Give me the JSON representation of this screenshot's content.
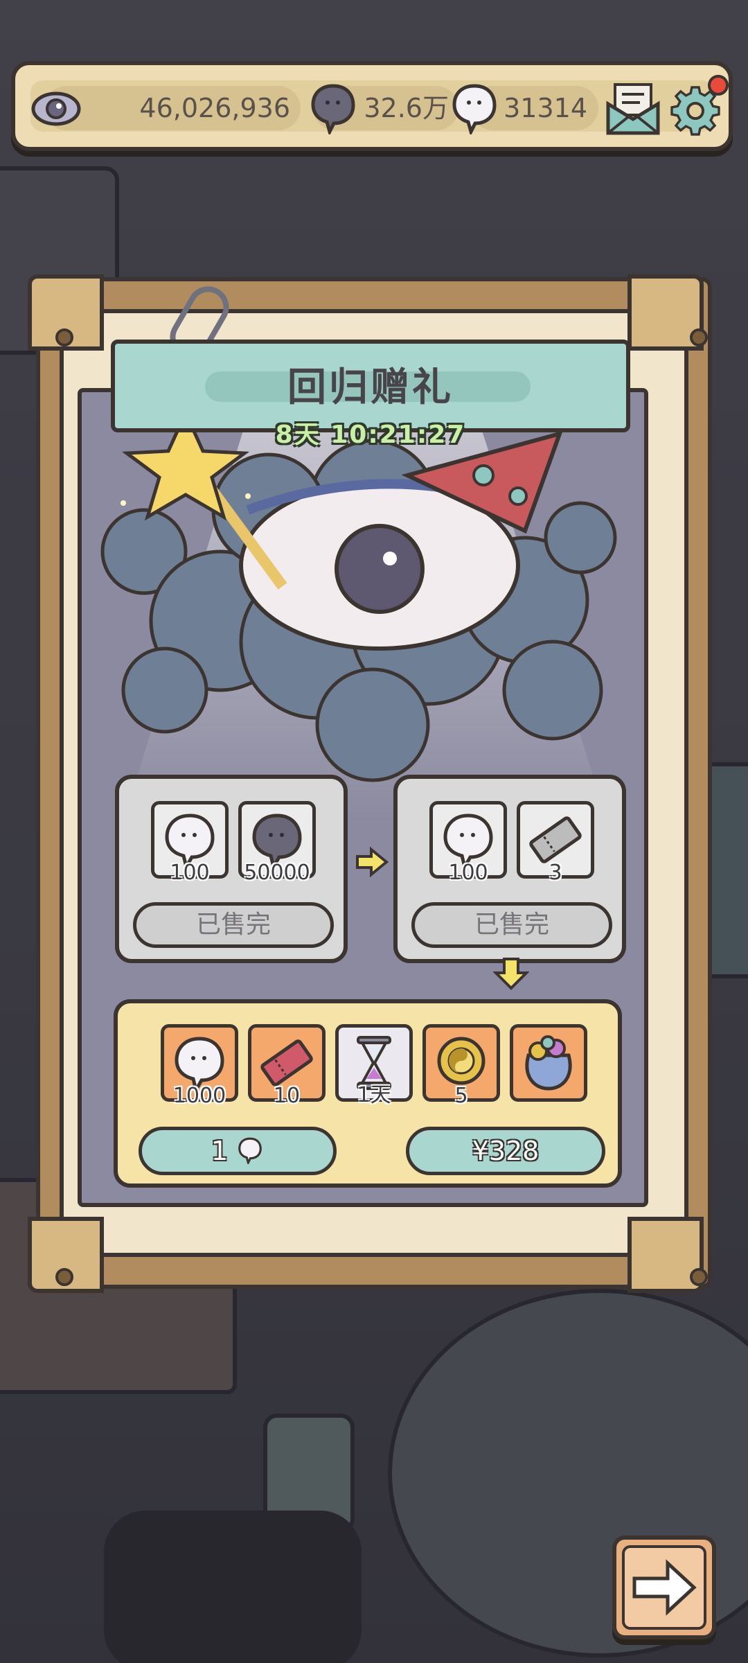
{
  "currency": {
    "eye_value": "46,026,936",
    "dark_value": "32.6万",
    "white_value": "31314"
  },
  "gift": {
    "title": "回归赠礼",
    "timer": "8天 10:21:27"
  },
  "offers": [
    {
      "items": [
        {
          "icon": "white-bubble-icon",
          "qty": "100"
        },
        {
          "icon": "dark-bubble-icon",
          "qty": "50000"
        }
      ],
      "status": "已售完"
    },
    {
      "items": [
        {
          "icon": "white-bubble-icon",
          "qty": "100"
        },
        {
          "icon": "ticket-icon",
          "qty": "3"
        }
      ],
      "status": "已售完"
    }
  ],
  "bundle": {
    "items": [
      {
        "icon": "white-bubble-icon",
        "qty": "1000"
      },
      {
        "icon": "red-ticket-icon",
        "qty": "10"
      },
      {
        "icon": "hourglass-icon",
        "qty": "1天"
      },
      {
        "icon": "yin-yang-coin-icon",
        "qty": "5"
      },
      {
        "icon": "treasure-bag-icon",
        "qty": ""
      }
    ],
    "price_bubble": "1",
    "price_money": "¥328"
  },
  "colors": {
    "panel_cream": "#f1e6cc",
    "banner_teal": "#a9d6cf",
    "timer_green": "#c9f0a6",
    "bundle_yellow": "#f6e3a8",
    "slot_orange": "#f4a86c"
  }
}
